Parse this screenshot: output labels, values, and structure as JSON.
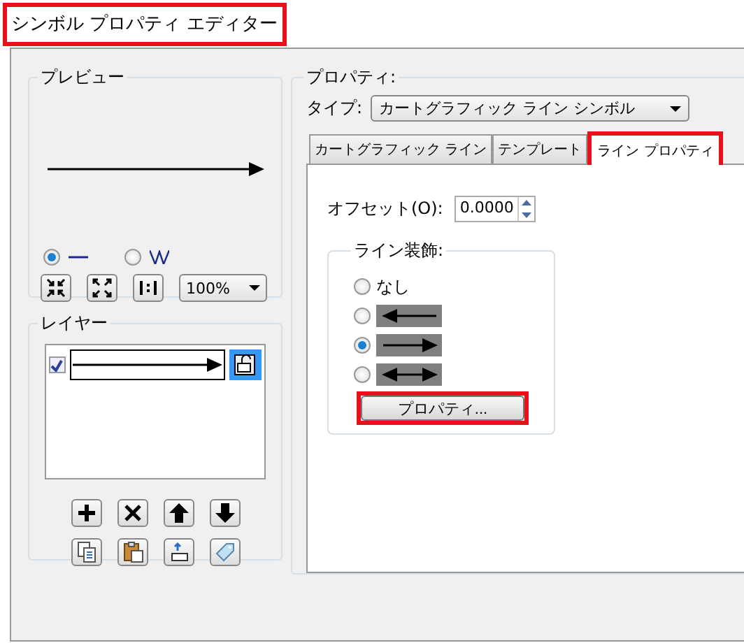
{
  "window": {
    "title": "シンボル プロパティ エディター",
    "highlighted": true
  },
  "preview": {
    "label": "プレビュー",
    "view_modes": [
      {
        "kind": "line",
        "selected": true
      },
      {
        "kind": "zigzag",
        "selected": false
      }
    ],
    "zoom": "100%"
  },
  "layers": {
    "label": "レイヤー",
    "rows": [
      {
        "visible": true,
        "selected": true
      }
    ]
  },
  "properties": {
    "label": "プロパティ:",
    "type_label": "タイプ:",
    "type_value": "カートグラフィック ライン シンボル",
    "tabs": [
      {
        "label": "カートグラフィック ライン",
        "selected": false,
        "highlighted": false
      },
      {
        "label": "テンプレート",
        "selected": false,
        "highlighted": false
      },
      {
        "label": "ライン プロパティ",
        "selected": true,
        "highlighted": true
      }
    ],
    "offset_label": "オフセット(O):",
    "offset_value": "0.0000",
    "decoration": {
      "label": "ライン装飾:",
      "options": [
        {
          "kind": "none",
          "label": "なし",
          "selected": false
        },
        {
          "kind": "arrow_start",
          "selected": false
        },
        {
          "kind": "arrow_end",
          "selected": true
        },
        {
          "kind": "arrow_both",
          "selected": false
        }
      ]
    },
    "button": {
      "label": "プロパティ...",
      "highlighted": true
    }
  }
}
